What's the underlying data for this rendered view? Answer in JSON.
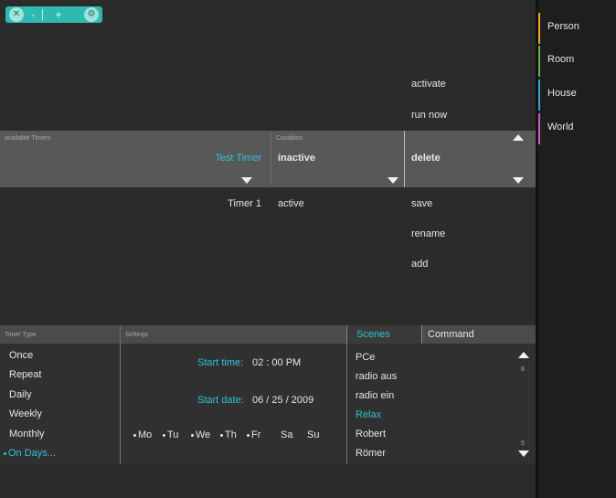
{
  "rail": [
    {
      "label": "Person",
      "color": "#f0a62a"
    },
    {
      "label": "Room",
      "color": "#5fb34a"
    },
    {
      "label": "House",
      "color": "#2fa7c8"
    },
    {
      "label": "World",
      "color": "#c75bc8"
    }
  ],
  "actions_top": {
    "activate": "activate",
    "run_now": "run now"
  },
  "timers_header": {
    "available_label": "available Timers",
    "condition_label": "Condition",
    "selected_timer": "Test Timer",
    "selected_condition": "inactive",
    "delete_label": "delete"
  },
  "timers": [
    {
      "name": "Timer 1",
      "condition": "active"
    }
  ],
  "actions_bottom": {
    "save": "save",
    "rename": "rename",
    "add": "add"
  },
  "bottom_header": {
    "timer_type": "Timer Type",
    "settings": "Settings",
    "scenes_tab": "Scenes",
    "command_tab": "Command"
  },
  "timer_types": [
    "Once",
    "Repeat",
    "Daily",
    "Weekly",
    "Monthly",
    "On Days..."
  ],
  "settings": {
    "start_time_label": "Start time:",
    "start_time_value": "02 : 00 PM",
    "start_date_label": "Start date:",
    "start_date_value": "06 / 25 / 2009",
    "days": [
      {
        "label": "Mo",
        "dot": true
      },
      {
        "label": "Tu",
        "dot": true
      },
      {
        "label": "We",
        "dot": true
      },
      {
        "label": "Th",
        "dot": true
      },
      {
        "label": "Fr",
        "dot": true
      },
      {
        "label": "Sa",
        "dot": false
      },
      {
        "label": "Su",
        "dot": false
      }
    ]
  },
  "scenes": [
    "PCe",
    "radio aus",
    "radio ein",
    "Relax",
    "Robert",
    "Römer"
  ],
  "scroll_counts": {
    "top": "8",
    "bottom": "5"
  },
  "colors": {
    "accent_cyan": "#2fc3d6",
    "toolbar_teal": "#2fb9b0"
  },
  "toolbar_icons": [
    "close-icon",
    "minus-icon",
    "plus-icon",
    "settings-icon"
  ]
}
